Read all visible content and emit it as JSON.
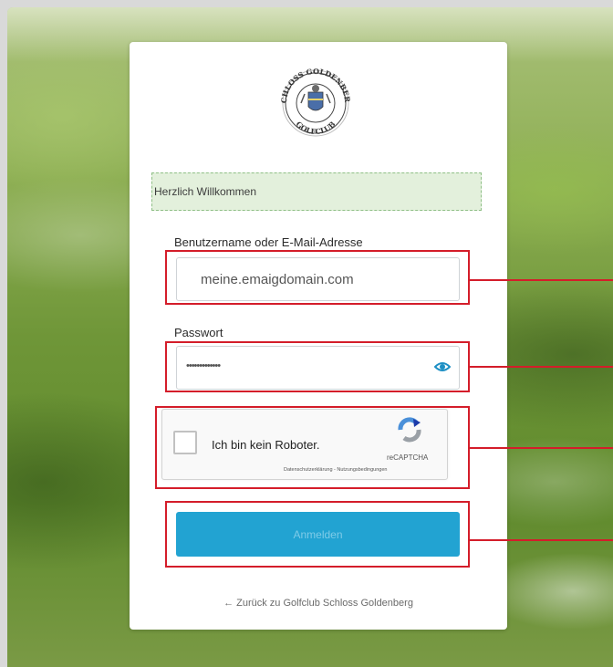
{
  "logo": {
    "text_top": "SCHLOSS GOLDENBERG",
    "text_bottom": "GOLFCLUB"
  },
  "welcome_message": "Herzlich Willkommen",
  "username": {
    "label": "Benutzername oder E-Mail-Adresse",
    "value": "meine.emaigdomain.com"
  },
  "password": {
    "label": "Passwort",
    "value": "•••••••••••••"
  },
  "recaptcha": {
    "label": "Ich bin kein Roboter.",
    "brand": "reCAPTCHA",
    "links": "Datenschutzerklärung - Nutzungsbedingungen"
  },
  "submit_label": "Anmelden",
  "back_link": "← Zurück zu Golfclub Schloss Goldenberg",
  "colors": {
    "accent": "#22a3d2",
    "highlight": "#d41d2a",
    "welcome_bg": "#e3f0dc"
  }
}
